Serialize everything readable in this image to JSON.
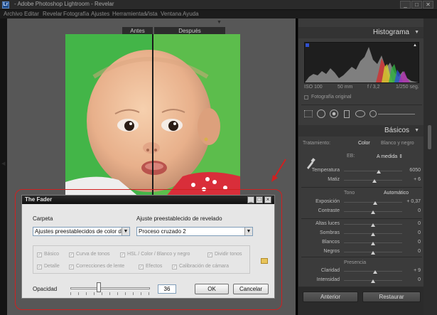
{
  "window": {
    "title": "- Adobe Photoshop Lightroom - Revelar",
    "app_icon": "Lr"
  },
  "menu": [
    "Archivo",
    "Editar",
    "Revelar",
    "Fotografía",
    "Ajustes",
    "Herramientas",
    "Vista",
    "Ventana",
    "Ayuda"
  ],
  "photo": {
    "before_label": "Antes",
    "after_label": "Después"
  },
  "histogram": {
    "title": "Histograma",
    "iso": "ISO 100",
    "focal": "50 mm",
    "aperture": "f / 3,2",
    "shutter": "1/250 seg.",
    "original_photo": "Fotografía original"
  },
  "basics": {
    "title": "Básicos",
    "treatment_label": "Tratamiento:",
    "treatment_color": "Color",
    "treatment_bw": "Blanco y negro",
    "wb_label": "EB:",
    "wb_value": "A medida",
    "sliders1": [
      {
        "label": "Temperatura",
        "value": "6050",
        "pos": 0.6
      },
      {
        "label": "Matiz",
        "value": "+ 6",
        "pos": 0.52
      }
    ],
    "tone_label": "Tono",
    "auto_label": "Automático",
    "sliders2": [
      {
        "label": "Exposición",
        "value": "+ 0,37",
        "pos": 0.54
      },
      {
        "label": "Contraste",
        "value": "0",
        "pos": 0.5
      }
    ],
    "sliders3": [
      {
        "label": "Altas luces",
        "value": "0",
        "pos": 0.5
      },
      {
        "label": "Sombras",
        "value": "0",
        "pos": 0.5
      },
      {
        "label": "Blancos",
        "value": "0",
        "pos": 0.5
      },
      {
        "label": "Negros",
        "value": "0",
        "pos": 0.5
      }
    ],
    "presence_label": "Presencia",
    "sliders4": [
      {
        "label": "Claridad",
        "value": "+ 9",
        "pos": 0.54
      },
      {
        "label": "Intensidad",
        "value": "0",
        "pos": 0.5
      }
    ]
  },
  "footer": {
    "previous": "Anterior",
    "reset": "Restaurar"
  },
  "fader": {
    "title": "The Fader",
    "folder_label": "Carpeta",
    "folder_value": "Ajustes preestablecidos de color de",
    "preset_label": "Ajuste preestablecido de revelado",
    "preset_value": "Proceso cruzado 2",
    "checks_row1": [
      "Básico",
      "Curva de tonos",
      "HSL / Color / Blanco y negro",
      "Dividir tonos"
    ],
    "checks_row2": [
      "Detalle",
      "Correcciones de lente",
      "Efectos",
      "Calibración de cámara"
    ],
    "opacity_label": "Opacidad",
    "opacity_value": "36",
    "opacity_level": 0.36,
    "ok_label": "OK",
    "cancel_label": "Cancelar"
  },
  "colors": {
    "accent_red": "#d02020",
    "green_backdrop": "#4db74a"
  },
  "icons": [
    "lightroom-icon",
    "crop-overlay-icon",
    "spot-removal-icon",
    "red-eye-icon",
    "graduated-filter-icon",
    "radial-filter-icon",
    "adjustment-brush-icon",
    "eyedropper-icon",
    "folder-icon",
    "checkmark-icon",
    "dropdown-arrow-icon"
  ]
}
